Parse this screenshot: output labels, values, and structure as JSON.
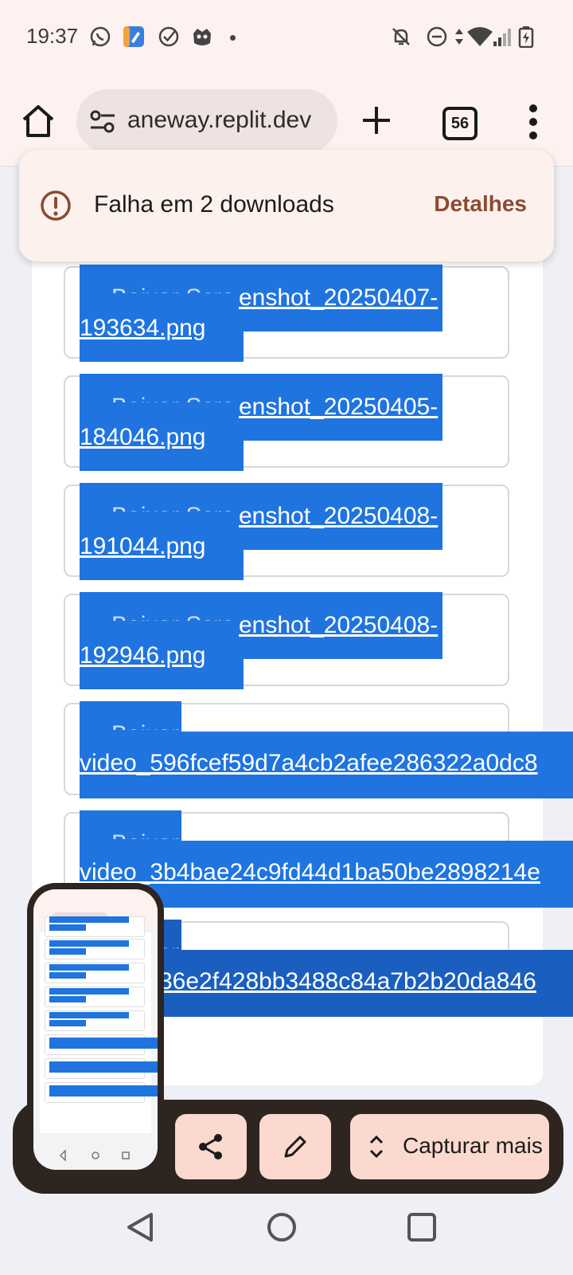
{
  "status_bar": {
    "time": "19:37",
    "left_icons": [
      "whatsapp-icon",
      "app-edit-icon",
      "check-circle-icon",
      "mascot-icon",
      "notification-dot"
    ],
    "right_icons": [
      "bell-off-icon",
      "dnd-icon",
      "data-arrows-icon",
      "wifi-icon",
      "signal-icon",
      "battery-charging-icon"
    ]
  },
  "browser": {
    "url": "aneway.replit.dev",
    "tab_count": "56",
    "icons": [
      "home-icon",
      "site-settings-icon",
      "new-tab-icon",
      "tab-switcher-icon",
      "more-menu-icon"
    ]
  },
  "snackbar": {
    "message": "Falha em 2 downloads",
    "action": "Detalhes",
    "icon": "error-icon"
  },
  "downloads": [
    {
      "line1": "enshot_20250407-",
      "line2": "193634.png",
      "hidden_prefix": "Baixar Scre"
    },
    {
      "line1": "enshot_20250405-",
      "line2": "184046.png",
      "hidden_prefix": "Baixar Scre"
    },
    {
      "line1": "enshot_20250408-",
      "line2": "191044.png",
      "hidden_prefix": "Baixar Scre"
    },
    {
      "line1": "enshot_20250408-",
      "line2": "192946.png",
      "hidden_prefix": "Baixar Scre"
    },
    {
      "line1": "Baixar",
      "line2": "video_596fcef59d7a4cb2afee286322a0dc8"
    },
    {
      "line1": "Baixar",
      "line2": "video_3b4bae24c9fd44d1ba50be2898214e"
    },
    {
      "line1": "Baixar",
      "line2": "36e2f428bb3488c84a7b2b20da846"
    }
  ],
  "capture_toolbar": {
    "more_label": "Capturar mais",
    "icons": [
      "share-icon",
      "edit-icon",
      "expand-icon"
    ]
  },
  "colors": {
    "accent": "#1f74e0",
    "toolbar_bg": "#fdf2ef",
    "capture_button_bg": "#fbd9cf",
    "details_text": "#8a4b31"
  }
}
